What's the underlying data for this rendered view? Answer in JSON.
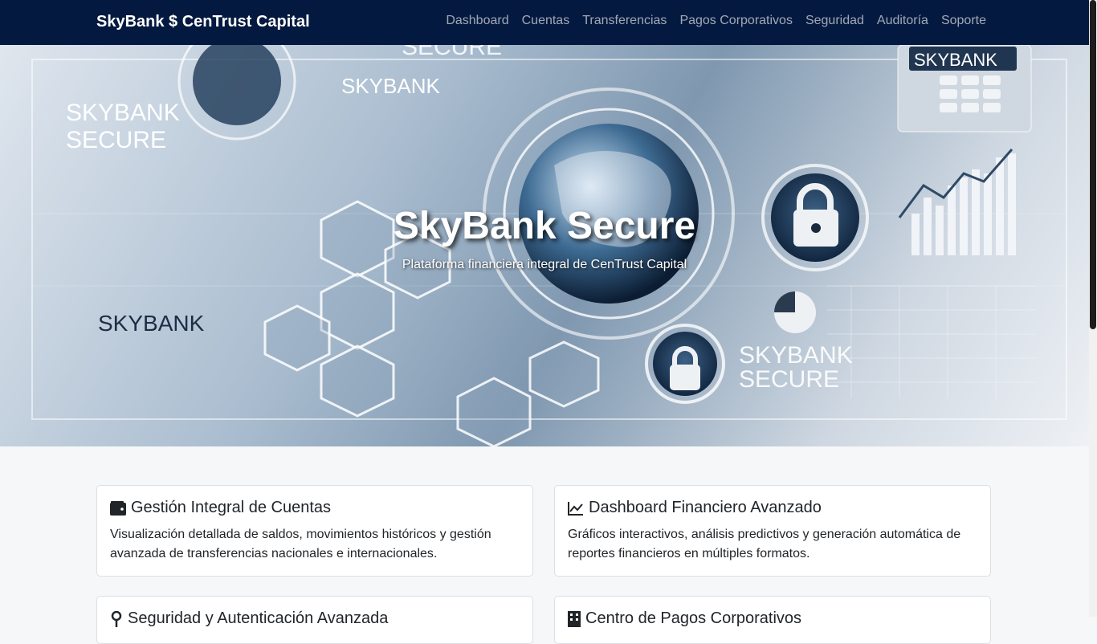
{
  "navbar": {
    "brand": "SkyBank $ CenTrust Capital",
    "items": [
      "Dashboard",
      "Cuentas",
      "Transferencias",
      "Pagos Corporativos",
      "Seguridad",
      "Auditoría",
      "Soporte"
    ]
  },
  "hero": {
    "title": "SkyBank Secure",
    "subtitle": "Plataforma financiera integral de CenTrust Capital",
    "image_texts": {
      "top_secure": "SECURE",
      "logo_top_center": "SKYBANK",
      "logo_top_right": "SKYBANK",
      "logo_left_line1": "SKYBANK",
      "logo_left_line2": "SECURE",
      "logo_bottom_left": "SKYBANK",
      "logo_bottom_right_line1": "SKYBANK",
      "logo_bottom_right_line2": "SECURE"
    }
  },
  "cards": [
    {
      "icon": "wallet-icon",
      "title": "Gestión Integral de Cuentas",
      "text": "Visualización detallada de saldos, movimientos históricos y gestión avanzada de transferencias nacionales e internacionales."
    },
    {
      "icon": "chart-line-icon",
      "title": "Dashboard Financiero Avanzado",
      "text": "Gráficos interactivos, análisis predictivos y generación automática de reportes financieros en múltiples formatos."
    },
    {
      "icon": "key-icon",
      "title": "Seguridad y Autenticación Avanzada",
      "text": ""
    },
    {
      "icon": "building-icon",
      "title": "Centro de Pagos Corporativos",
      "text": ""
    }
  ],
  "colors": {
    "navbar": "#04193f",
    "page_bg": "#f6f7f9"
  }
}
